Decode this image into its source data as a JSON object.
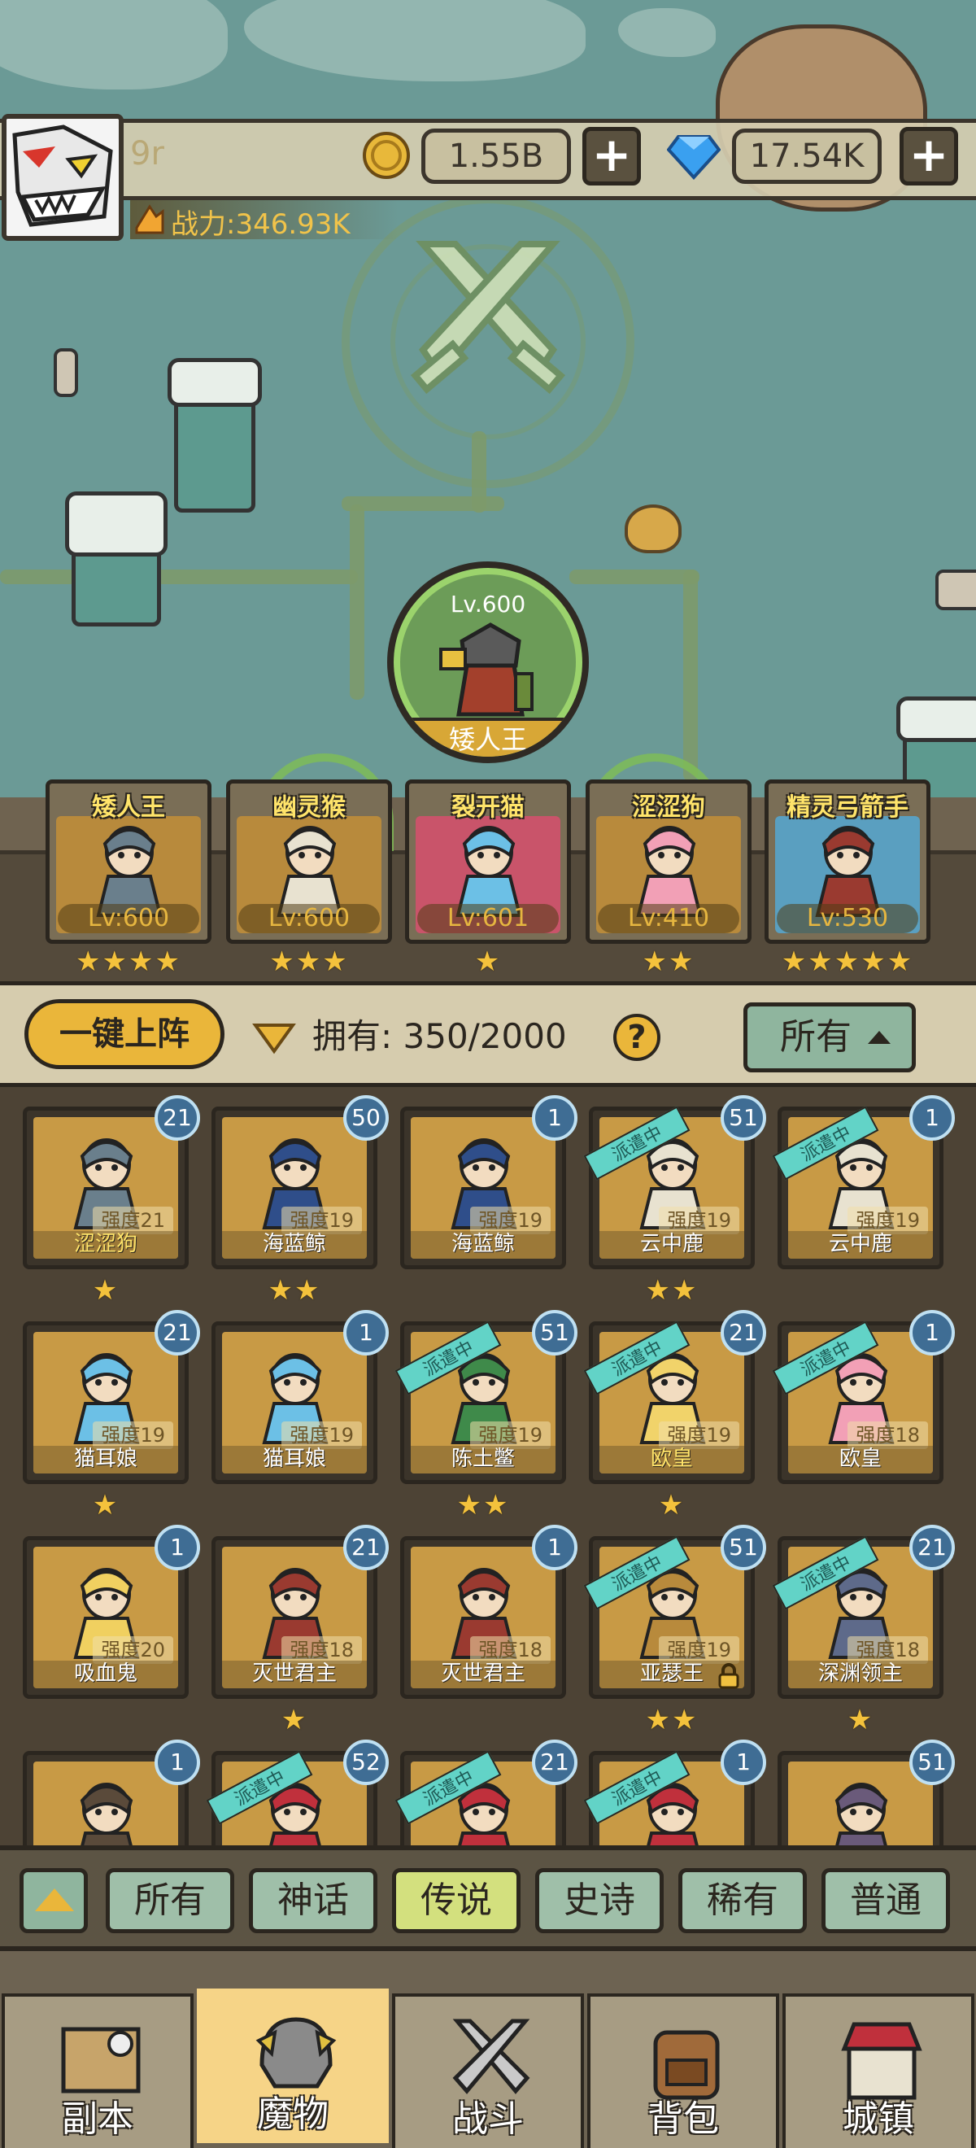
{
  "player": {
    "name": "9r",
    "power": "战力:346.93K"
  },
  "resources": {
    "coins": "1.55B",
    "gems": "17.54K",
    "plus": "+"
  },
  "featured": {
    "level": "Lv.600",
    "name": "矮人王"
  },
  "team": [
    {
      "name": "矮人王",
      "level": "Lv:600",
      "stars": "★★★★",
      "color": "#b88a3c"
    },
    {
      "name": "幽灵猴",
      "level": "Lv:600",
      "stars": "★★★",
      "color": "#b88a3c"
    },
    {
      "name": "裂开猫",
      "level": "Lv:601",
      "stars": "★",
      "color": "#c9546a"
    },
    {
      "name": "涩涩狗",
      "level": "Lv:410",
      "stars": "★★",
      "color": "#b88a3c"
    },
    {
      "name": "精灵弓箭手",
      "level": "Lv:530",
      "stars": "★★★★★",
      "color": "#5a9fc0"
    }
  ],
  "controls": {
    "deploy": "一键上阵",
    "owned": "拥有: 350/2000",
    "help": "?",
    "filter": "所有"
  },
  "grid": {
    "dispatch_label": "派遣中",
    "cards": [
      {
        "name": "涩涩狗",
        "count": "21",
        "strength": "强度21",
        "stars": "★",
        "dispatched": false,
        "yellow": true
      },
      {
        "name": "海蓝鲸",
        "count": "50",
        "strength": "强度19",
        "stars": "★★",
        "dispatched": false,
        "yellow": false
      },
      {
        "name": "海蓝鲸",
        "count": "1",
        "strength": "强度19",
        "stars": "",
        "dispatched": false,
        "yellow": false
      },
      {
        "name": "云中鹿",
        "count": "51",
        "strength": "强度19",
        "stars": "★★",
        "dispatched": true,
        "yellow": false
      },
      {
        "name": "云中鹿",
        "count": "1",
        "strength": "强度19",
        "stars": "",
        "dispatched": true,
        "yellow": false
      },
      {
        "name": "猫耳娘",
        "count": "21",
        "strength": "强度19",
        "stars": "★",
        "dispatched": false,
        "yellow": false
      },
      {
        "name": "猫耳娘",
        "count": "1",
        "strength": "强度19",
        "stars": "",
        "dispatched": false,
        "yellow": false
      },
      {
        "name": "陈土鳖",
        "count": "51",
        "strength": "强度19",
        "stars": "★★",
        "dispatched": true,
        "yellow": false
      },
      {
        "name": "欧皇",
        "count": "21",
        "strength": "强度19",
        "stars": "★",
        "dispatched": true,
        "yellow": true
      },
      {
        "name": "欧皇",
        "count": "1",
        "strength": "强度18",
        "stars": "",
        "dispatched": true,
        "yellow": false
      },
      {
        "name": "吸血鬼",
        "count": "1",
        "strength": "强度20",
        "stars": "",
        "dispatched": false,
        "yellow": false
      },
      {
        "name": "灭世君主",
        "count": "21",
        "strength": "强度18",
        "stars": "★",
        "dispatched": false,
        "yellow": false
      },
      {
        "name": "灭世君主",
        "count": "1",
        "strength": "强度18",
        "stars": "",
        "dispatched": false,
        "yellow": false
      },
      {
        "name": "亚瑟王",
        "count": "51",
        "strength": "强度19",
        "stars": "★★",
        "dispatched": true,
        "yellow": false,
        "locked": true
      },
      {
        "name": "深渊领主",
        "count": "21",
        "strength": "强度18",
        "stars": "★",
        "dispatched": true,
        "yellow": false
      },
      {
        "name": "",
        "count": "1",
        "strength": "",
        "stars": "",
        "dispatched": false,
        "yellow": false
      },
      {
        "name": "",
        "count": "52",
        "strength": "",
        "stars": "",
        "dispatched": true,
        "yellow": false
      },
      {
        "name": "",
        "count": "21",
        "strength": "",
        "stars": "",
        "dispatched": true,
        "yellow": false
      },
      {
        "name": "",
        "count": "1",
        "strength": "",
        "stars": "",
        "dispatched": true,
        "yellow": false
      },
      {
        "name": "",
        "count": "51",
        "strength": "",
        "stars": "",
        "dispatched": false,
        "yellow": false
      }
    ]
  },
  "rarity_filters": [
    "所有",
    "神话",
    "传说",
    "史诗",
    "稀有",
    "普通"
  ],
  "rarity_active": "传说",
  "nav": [
    {
      "label": "副本",
      "icon": "map-icon"
    },
    {
      "label": "魔物",
      "icon": "helmet-icon"
    },
    {
      "label": "战斗",
      "icon": "crossed-swords-icon"
    },
    {
      "label": "背包",
      "icon": "backpack-icon"
    },
    {
      "label": "城镇",
      "icon": "shop-icon"
    }
  ],
  "nav_active": "魔物",
  "colors": {
    "gold": "#eab63a",
    "badge": "#3f6d94",
    "dispatch": "#62d3c7",
    "star": "#f4c23c"
  }
}
